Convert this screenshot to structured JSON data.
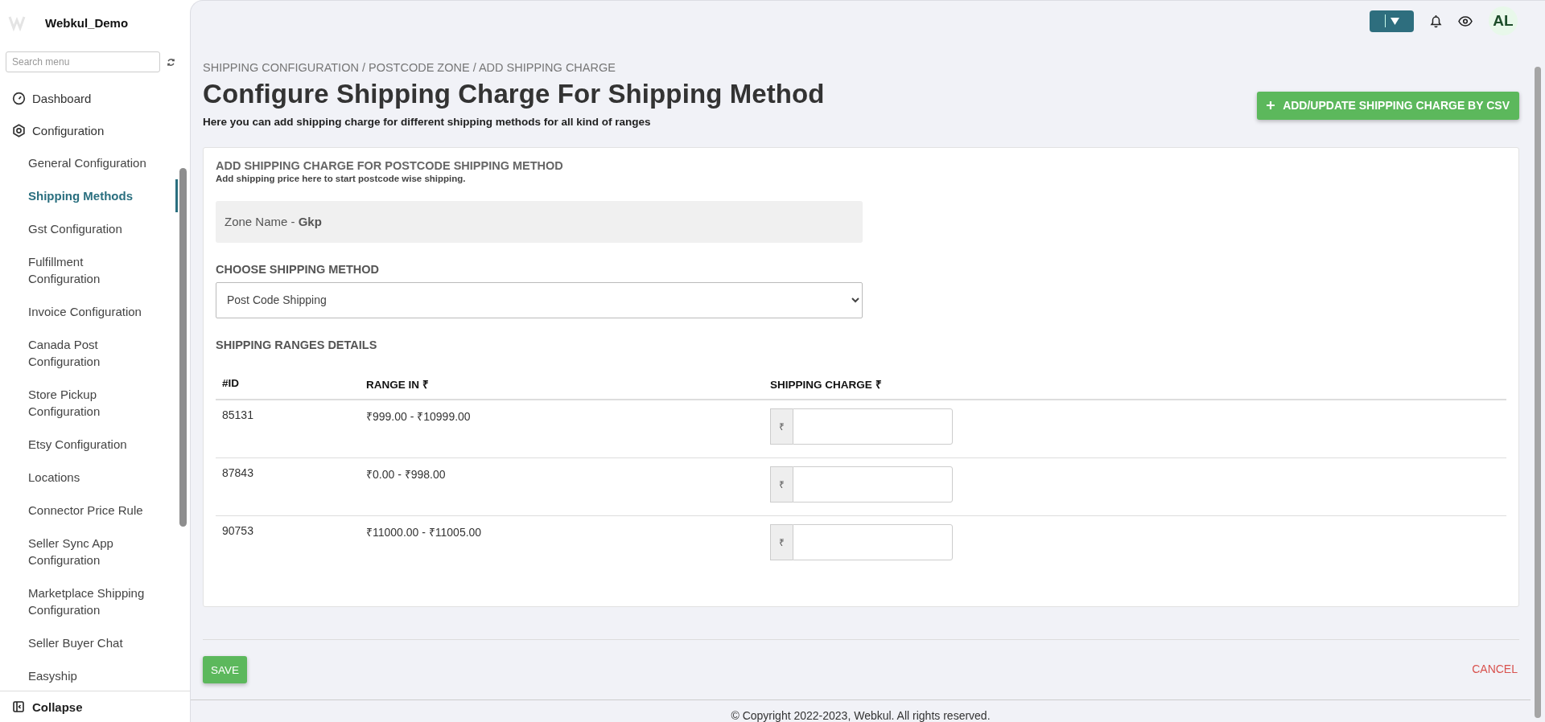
{
  "app": {
    "name": "Webkul_Demo"
  },
  "sidebar": {
    "search": {
      "placeholder": "Search menu"
    },
    "items": [
      {
        "label": "Dashboard",
        "selected": false
      },
      {
        "label": "Configuration",
        "selected": false,
        "expanded": true,
        "children": [
          {
            "label": "General Configuration",
            "selected": false
          },
          {
            "label": "Shipping Methods",
            "selected": true
          },
          {
            "label": "Gst Configuration",
            "selected": false
          },
          {
            "label": "Fulfillment Configuration",
            "selected": false
          },
          {
            "label": "Invoice Configuration",
            "selected": false
          },
          {
            "label": "Canada Post Configuration",
            "selected": false
          },
          {
            "label": "Store Pickup Configuration",
            "selected": false
          },
          {
            "label": "Etsy Configuration",
            "selected": false
          },
          {
            "label": "Locations",
            "selected": false
          },
          {
            "label": "Connector Price Rule",
            "selected": false
          },
          {
            "label": "Seller Sync App Configuration",
            "selected": false
          },
          {
            "label": "Marketplace Shipping Configuration",
            "selected": false
          },
          {
            "label": "Seller Buyer Chat",
            "selected": false
          },
          {
            "label": "Easyship",
            "selected": false
          }
        ]
      }
    ],
    "collapse": "Collapse"
  },
  "header": {
    "avatar": "AL"
  },
  "page": {
    "breadcrumb": "SHIPPING CONFIGURATION / POSTCODE ZONE / ADD SHIPPING CHARGE",
    "title": "Configure Shipping Charge For Shipping Method",
    "subtitle": "Here you can add shipping charge for different shipping methods for all kind of ranges",
    "csv_button": "ADD/UPDATE SHIPPING CHARGE BY CSV"
  },
  "card": {
    "heading": "ADD SHIPPING CHARGE FOR POSTCODE SHIPPING METHOD",
    "note": "Add shipping price here to start postcode wise shipping.",
    "zone": "Zone Name - **Gkp**",
    "shipping_method": {
      "label": "CHOOSE SHIPPING METHOD",
      "value": "Post Code Shipping"
    },
    "ranges": {
      "title": "SHIPPING RANGES DETAILS",
      "columns": [
        "#ID",
        "RANGE IN ₹",
        "SHIPPING CHARGE ₹"
      ],
      "rows": [
        {
          "id": "85131",
          "range": "₹999.00 - ₹10999.00",
          "currency": "₹"
        },
        {
          "id": "87843",
          "range": "₹0.00 - ₹998.00",
          "currency": "₹"
        },
        {
          "id": "90753",
          "range": "₹11000.00 - ₹11005.00",
          "currency": "₹"
        }
      ]
    }
  },
  "actions": {
    "save": "SAVE",
    "cancel": "CANCEL"
  },
  "footer": "© Copyright 2022-2023, Webkul. All rights reserved."
}
